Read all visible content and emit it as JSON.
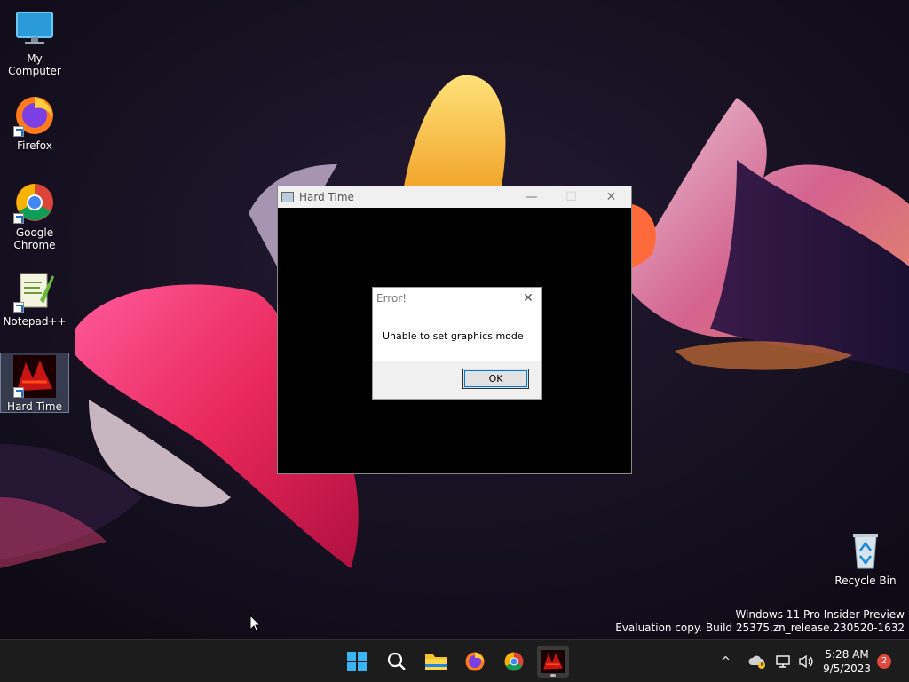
{
  "desktop": {
    "icons": [
      {
        "label": "My Computer",
        "icon": "monitor-icon"
      },
      {
        "label": "Firefox",
        "icon": "firefox-icon"
      },
      {
        "label": "Google\nChrome",
        "icon": "chrome-icon"
      },
      {
        "label": "Notepad++",
        "icon": "notepadpp-icon"
      },
      {
        "label": "Hard Time",
        "icon": "hard-time-icon"
      }
    ],
    "recycle_bin": {
      "label": "Recycle Bin",
      "icon": "recycle-bin-icon"
    }
  },
  "app_window": {
    "title": "Hard Time",
    "buttons": {
      "minimize": "—",
      "maximize": "☐",
      "close": "✕"
    }
  },
  "dialog": {
    "title": "Error!",
    "message": "Unable to set graphics mode",
    "ok_label": "OK",
    "close": "✕"
  },
  "watermark": {
    "line1": "Windows 11 Pro Insider Preview",
    "line2": "Evaluation copy. Build 25375.zn_release.230520-1632"
  },
  "taskbar": {
    "pinned": [
      "start-icon",
      "search-icon",
      "file-explorer-icon",
      "firefox-icon",
      "chrome-icon",
      "hard-time-icon"
    ],
    "clock": {
      "time": "5:28 AM",
      "date": "9/5/2023"
    },
    "notification_count": "2",
    "tray_chevron": "^"
  },
  "colors": {
    "accent": "#0078d7",
    "badge": "#e0483e",
    "taskbar": "#1c1c1c"
  }
}
